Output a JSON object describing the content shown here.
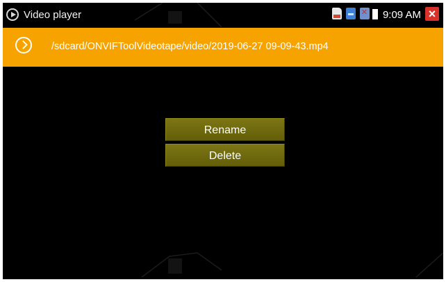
{
  "statusbar": {
    "app_title": "Video player",
    "clock": "9:09 AM",
    "close_label": "×",
    "icons": [
      "sd-card-icon",
      "download-icon",
      "image-error-icon",
      "battery-icon"
    ]
  },
  "pathbar": {
    "path": "/sdcard/ONVIFToolVideotape/video/2019-06-27 09-09-43.mp4"
  },
  "menu": {
    "items": [
      {
        "label": "Rename"
      },
      {
        "label": "Delete"
      }
    ]
  },
  "colors": {
    "path_bar": "#f6a300",
    "menu_button": "#6e6810",
    "close_button": "#d9322b"
  }
}
